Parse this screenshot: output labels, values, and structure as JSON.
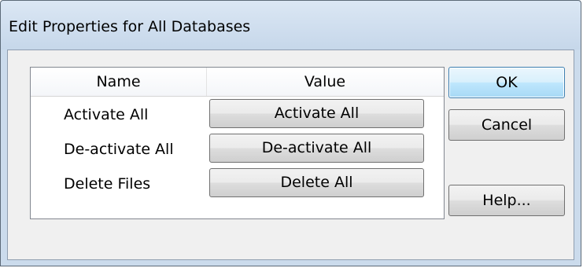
{
  "window": {
    "title": "Edit Properties for All Databases"
  },
  "grid": {
    "columns": [
      "Name",
      "Value"
    ],
    "rows": [
      {
        "name": "Activate All",
        "button": "Activate All"
      },
      {
        "name": "De-activate All",
        "button": "De-activate All"
      },
      {
        "name": "Delete Files",
        "button": "Delete All"
      }
    ]
  },
  "buttons": {
    "ok": "OK",
    "cancel": "Cancel",
    "help": "Help..."
  }
}
